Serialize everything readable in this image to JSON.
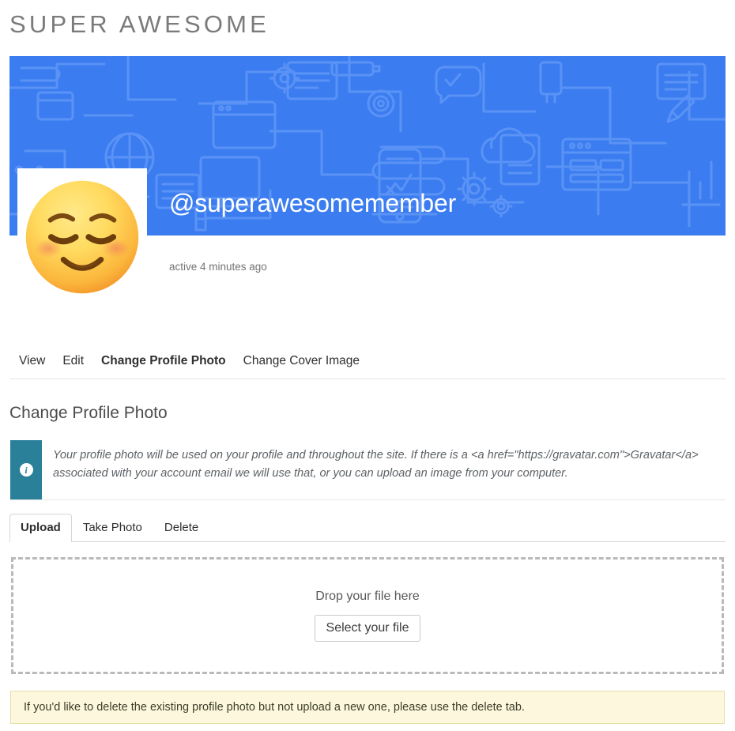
{
  "site": {
    "title": "SUPER AWESOME"
  },
  "profile": {
    "username": "@superawesomemember",
    "activity": "active 4 minutes ago",
    "avatar_emoji": "relieved-face-emoji",
    "cover_color": "#3b7cf0",
    "cover_line_color": "#5a93f5"
  },
  "profile_nav": {
    "items": [
      {
        "label": "View",
        "active": false
      },
      {
        "label": "Edit",
        "active": false
      },
      {
        "label": "Change Profile Photo",
        "active": true
      },
      {
        "label": "Change Cover Image",
        "active": false
      }
    ]
  },
  "section": {
    "title": "Change Profile Photo"
  },
  "info_notice": {
    "icon": "info-icon",
    "accent_color": "#2a7f99",
    "text": "Your profile photo will be used on your profile and throughout the site. If there is a <a href=\"https://gravatar.com\">Gravatar</a> associated with your account email we will use that, or you can upload an image from your computer."
  },
  "upload_tabs": {
    "items": [
      {
        "label": "Upload",
        "active": true
      },
      {
        "label": "Take Photo",
        "active": false
      },
      {
        "label": "Delete",
        "active": false
      }
    ]
  },
  "dropzone": {
    "prompt": "Drop your file here",
    "button_label": "Select your file"
  },
  "warning_notice": {
    "text": "If you'd like to delete the existing profile photo but not upload a new one, please use the delete tab.",
    "background_color": "#fdf8dd"
  }
}
